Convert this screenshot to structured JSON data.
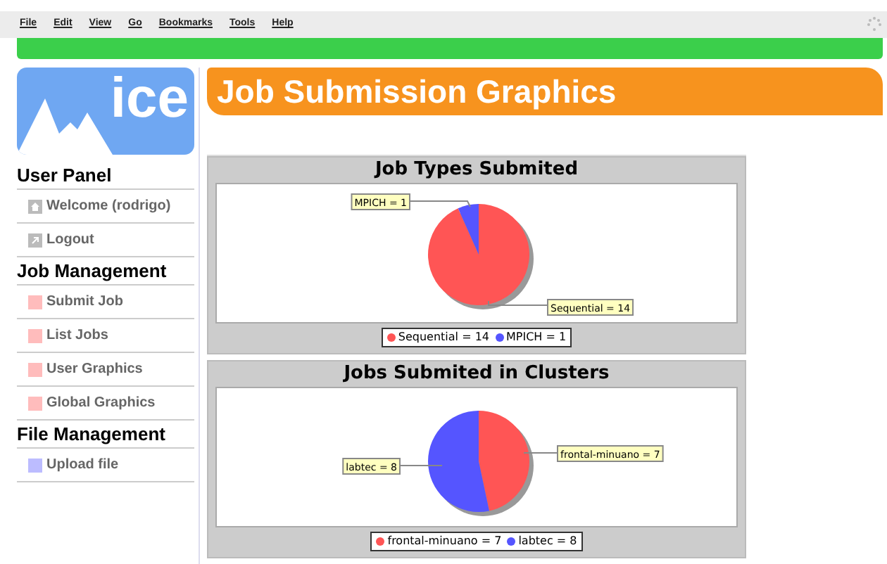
{
  "menu": [
    "File",
    "Edit",
    "View",
    "Go",
    "Bookmarks",
    "Tools",
    "Help"
  ],
  "logo": {
    "text": "ice"
  },
  "sidebar": [
    {
      "heading": "User Panel",
      "items": [
        {
          "label": "Welcome (rodrigo)",
          "kind": "home"
        },
        {
          "label": "Logout",
          "kind": "exit"
        }
      ]
    },
    {
      "heading": "Job Management",
      "items": [
        {
          "label": "Submit Job",
          "kind": "job"
        },
        {
          "label": "List Jobs",
          "kind": "job"
        },
        {
          "label": "User Graphics",
          "kind": "job"
        },
        {
          "label": "Global Graphics",
          "kind": "job"
        }
      ]
    },
    {
      "heading": "File Management",
      "items": [
        {
          "label": "Upload file",
          "kind": "file"
        }
      ]
    }
  ],
  "page_title": "Job Submission Graphics",
  "charts": [
    {
      "chart_data": {
        "type": "pie",
        "title": "Job Types Submited",
        "categories": [
          "Sequential = 14",
          "MPICH = 1"
        ],
        "values": [
          14,
          1
        ],
        "colors": [
          "#ff5555",
          "#5555ff"
        ]
      },
      "legend": [
        {
          "label": "Sequential = 14",
          "color": "#ff5555"
        },
        {
          "label": "MPICH = 1",
          "color": "#5555ff"
        }
      ]
    },
    {
      "chart_data": {
        "type": "pie",
        "title": "Jobs Submited in Clusters",
        "categories": [
          "frontal-minuano = 7",
          "labtec = 8"
        ],
        "values": [
          7,
          8
        ],
        "colors": [
          "#ff5555",
          "#5555ff"
        ]
      },
      "legend": [
        {
          "label": "frontal-minuano = 7",
          "color": "#ff5555"
        },
        {
          "label": "labtec = 8",
          "color": "#5555ff"
        }
      ]
    }
  ]
}
